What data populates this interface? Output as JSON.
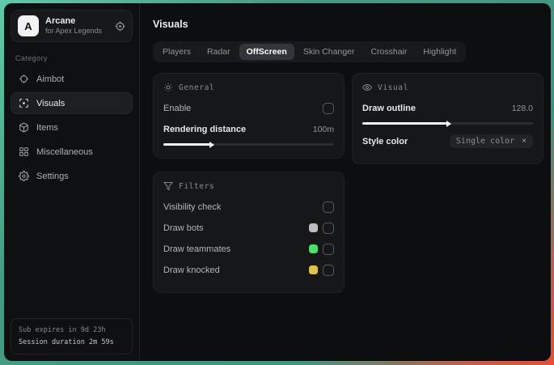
{
  "app": {
    "logo_letter": "A",
    "name": "Arcane",
    "subtitle": "for Apex Legends"
  },
  "sidebar": {
    "category_label": "Category",
    "items": [
      {
        "label": "Aimbot",
        "icon": "crosshair-icon",
        "selected": false
      },
      {
        "label": "Visuals",
        "icon": "eye-icon",
        "selected": true
      },
      {
        "label": "Items",
        "icon": "package-icon",
        "selected": false
      },
      {
        "label": "Miscellaneous",
        "icon": "grid-icon",
        "selected": false
      },
      {
        "label": "Settings",
        "icon": "gear-icon",
        "selected": false
      }
    ],
    "footer": {
      "sub_expiry": "Sub expires in 9d 23h",
      "session_duration": "Session duration 2m 59s"
    }
  },
  "header": {
    "title": "Visuals"
  },
  "tabs": [
    {
      "label": "Players",
      "selected": false
    },
    {
      "label": "Radar",
      "selected": false
    },
    {
      "label": "OffScreen",
      "selected": true
    },
    {
      "label": "Skin Changer",
      "selected": false
    },
    {
      "label": "Crosshair",
      "selected": false
    },
    {
      "label": "Highlight",
      "selected": false
    }
  ],
  "cards": {
    "general": {
      "title": "General",
      "enable_label": "Enable",
      "enable_checked": false,
      "rendering_distance_label": "Rendering distance",
      "rendering_distance_value": "100m",
      "rendering_distance_fill_pct": 28
    },
    "visual": {
      "title": "Visual",
      "draw_outline_label": "Draw outline",
      "draw_outline_value": "128.0",
      "draw_outline_fill_pct": 50,
      "style_color_label": "Style color",
      "style_color_selected": "Single color",
      "style_color_clear": "×"
    },
    "filters": {
      "title": "Filters",
      "rows": [
        {
          "label": "Visibility check",
          "swatch": null,
          "checked": false
        },
        {
          "label": "Draw bots",
          "swatch": "#bdbdbd",
          "checked": false
        },
        {
          "label": "Draw teammates",
          "swatch": "#4edd6a",
          "checked": false
        },
        {
          "label": "Draw knocked",
          "swatch": "#ddc24d",
          "checked": false
        }
      ]
    }
  },
  "colors": {
    "swatch_bots": "#bdbdbd",
    "swatch_teammates": "#4edd6a",
    "swatch_knocked": "#ddc24d",
    "wallpaper_teal": "#459c84",
    "wallpaper_red": "#e2503a",
    "selected_tab_bg": "#323539"
  }
}
